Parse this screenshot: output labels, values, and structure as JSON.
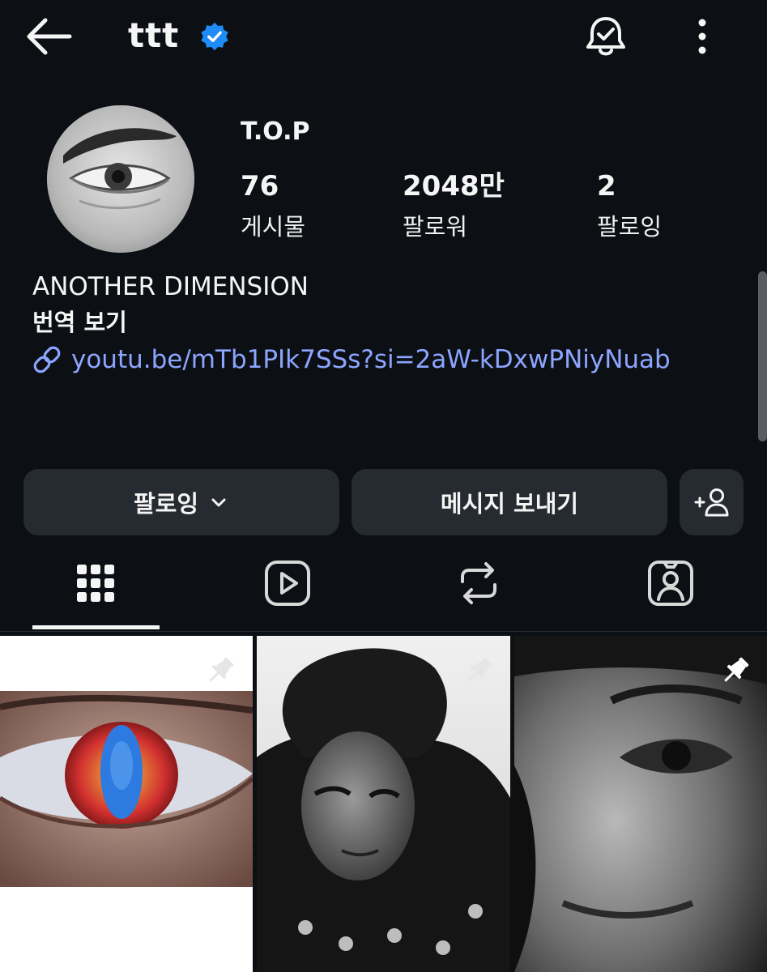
{
  "header": {
    "username": "ttt",
    "icons": {
      "back": "arrow-left-icon",
      "verified": "verified-badge-icon",
      "notifications": "bell-check-icon",
      "more": "more-vertical-icon"
    }
  },
  "profile": {
    "display_name": "T.O.P",
    "stats": [
      {
        "value": "76",
        "label": "게시물"
      },
      {
        "value": "2048만",
        "label": "팔로워"
      },
      {
        "value": "2",
        "label": "팔로잉"
      }
    ],
    "bio": "ANOTHER DIMENSION",
    "translate_label": "번역 보기",
    "link": "youtu.be/mTb1PIk7SSs?si=2aW-kDxwPNiyNuab"
  },
  "actions": {
    "follow_label": "팔로잉",
    "message_label": "메시지 보내기",
    "add_user_icon": "add-user-icon"
  },
  "tabs": [
    {
      "name": "posts",
      "icon": "grid-icon",
      "active": true
    },
    {
      "name": "reels",
      "icon": "reels-icon",
      "active": false
    },
    {
      "name": "reposts",
      "icon": "repost-icon",
      "active": false
    },
    {
      "name": "tagged",
      "icon": "tagged-person-icon",
      "active": false
    }
  ],
  "posts": [
    {
      "pinned": true,
      "description": "eye"
    },
    {
      "pinned": true,
      "description": "portrait"
    },
    {
      "pinned": true,
      "description": "close-up"
    }
  ],
  "colors": {
    "background": "#0c0f14",
    "button": "#262a31",
    "link": "#8ca5ff",
    "verified": "#1d8cf8"
  }
}
